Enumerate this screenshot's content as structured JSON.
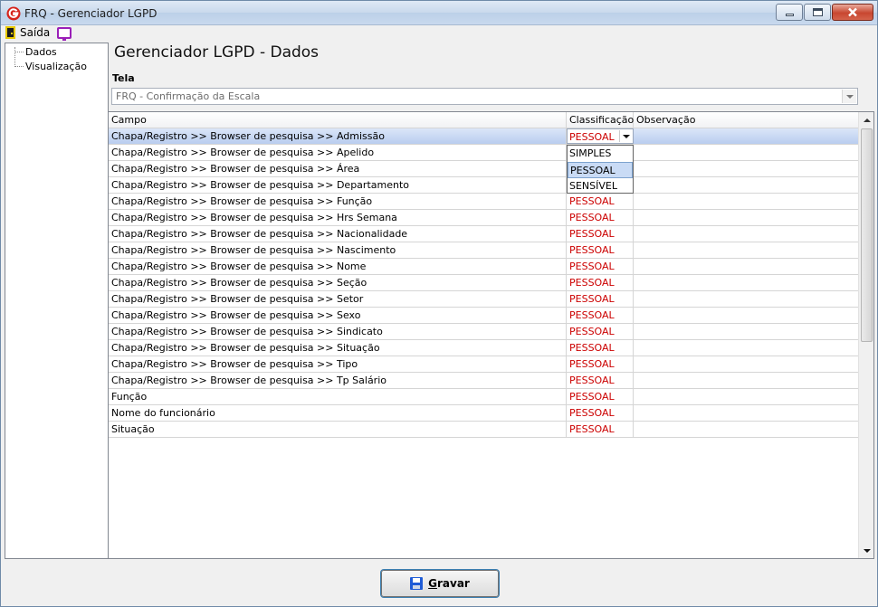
{
  "window": {
    "title": "FRQ - Gerenciador LGPD"
  },
  "menu": {
    "exit_label": "Saída"
  },
  "tree": {
    "items": [
      "Dados",
      "Visualização"
    ]
  },
  "page": {
    "title": "Gerenciador LGPD - Dados"
  },
  "screen_field": {
    "label": "Tela",
    "value": "FRQ - Confirmação da Escala"
  },
  "grid": {
    "columns": [
      "Campo",
      "Classificação",
      "Observação"
    ],
    "rows": [
      {
        "campo": "Chapa/Registro >> Browser de pesquisa >> Admissão",
        "classificacao": "PESSOAL",
        "observacao": ""
      },
      {
        "campo": "Chapa/Registro >> Browser de pesquisa >> Apelido",
        "classificacao": "",
        "observacao": ""
      },
      {
        "campo": "Chapa/Registro >> Browser de pesquisa >> Área",
        "classificacao": "",
        "observacao": ""
      },
      {
        "campo": "Chapa/Registro >> Browser de pesquisa >> Departamento",
        "classificacao": "",
        "observacao": ""
      },
      {
        "campo": "Chapa/Registro >> Browser de pesquisa >> Função",
        "classificacao": "PESSOAL",
        "observacao": ""
      },
      {
        "campo": "Chapa/Registro >> Browser de pesquisa >> Hrs Semana",
        "classificacao": "PESSOAL",
        "observacao": ""
      },
      {
        "campo": "Chapa/Registro >> Browser de pesquisa >> Nacionalidade",
        "classificacao": "PESSOAL",
        "observacao": ""
      },
      {
        "campo": "Chapa/Registro >> Browser de pesquisa >> Nascimento",
        "classificacao": "PESSOAL",
        "observacao": ""
      },
      {
        "campo": "Chapa/Registro >> Browser de pesquisa >> Nome",
        "classificacao": "PESSOAL",
        "observacao": ""
      },
      {
        "campo": "Chapa/Registro >> Browser de pesquisa >> Seção",
        "classificacao": "PESSOAL",
        "observacao": ""
      },
      {
        "campo": "Chapa/Registro >> Browser de pesquisa >> Setor",
        "classificacao": "PESSOAL",
        "observacao": ""
      },
      {
        "campo": "Chapa/Registro >> Browser de pesquisa >> Sexo",
        "classificacao": "PESSOAL",
        "observacao": ""
      },
      {
        "campo": "Chapa/Registro >> Browser de pesquisa >> Sindicato",
        "classificacao": "PESSOAL",
        "observacao": ""
      },
      {
        "campo": "Chapa/Registro >> Browser de pesquisa >> Situação",
        "classificacao": "PESSOAL",
        "observacao": ""
      },
      {
        "campo": "Chapa/Registro >> Browser de pesquisa >> Tipo",
        "classificacao": "PESSOAL",
        "observacao": ""
      },
      {
        "campo": "Chapa/Registro >> Browser de pesquisa >> Tp Salário",
        "classificacao": "PESSOAL",
        "observacao": ""
      },
      {
        "campo": "Função",
        "classificacao": "PESSOAL",
        "observacao": ""
      },
      {
        "campo": "Nome do funcionário",
        "classificacao": "PESSOAL",
        "observacao": ""
      },
      {
        "campo": "Situação",
        "classificacao": "PESSOAL",
        "observacao": ""
      }
    ],
    "selected_row": 0
  },
  "dropdown": {
    "options": [
      "SIMPLES",
      "PESSOAL",
      "SENSÍVEL"
    ],
    "highlighted": "PESSOAL"
  },
  "footer": {
    "save_label_prefix": "G",
    "save_label_rest": "ravar"
  },
  "icons": {
    "app": "app-logo-icon",
    "exit": "door-exit-icon",
    "monitor": "monitor-icon",
    "save": "floppy-disk-icon"
  },
  "colors": {
    "classification_text": "#cc0000",
    "selection": "#b9cdef",
    "close_button": "#c84730"
  }
}
